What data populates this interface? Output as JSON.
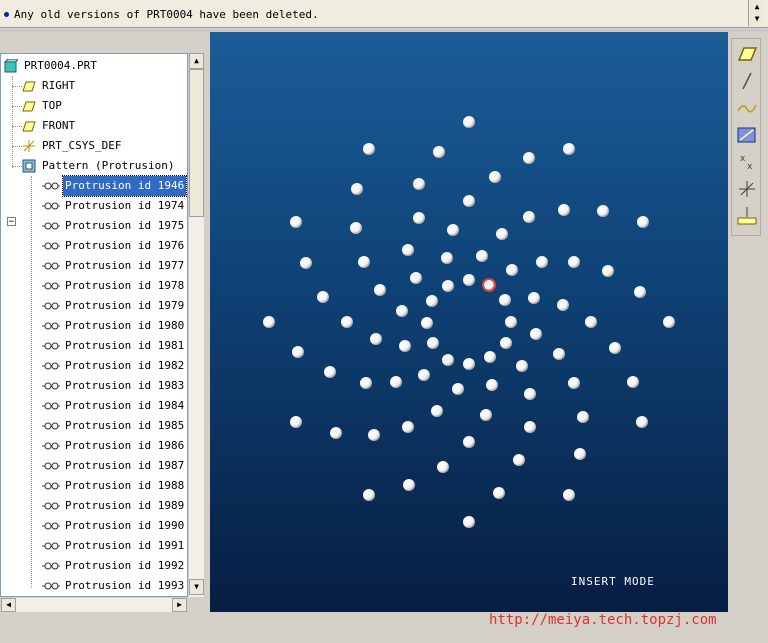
{
  "message_bar": {
    "text": "Any old versions of PRT0004 have been deleted."
  },
  "model_tree": {
    "root": "PRT0004.PRT",
    "items": [
      {
        "label": "RIGHT",
        "icon": "datum-plane-icon"
      },
      {
        "label": "TOP",
        "icon": "datum-plane-icon"
      },
      {
        "label": "FRONT",
        "icon": "datum-plane-icon"
      },
      {
        "label": "PRT_CSYS_DEF",
        "icon": "coordinate-system-icon"
      },
      {
        "label": "Pattern (Protrusion)",
        "icon": "pattern-icon"
      }
    ],
    "pattern_members": [
      "Protrusion id 1946",
      "Protrusion id 1974",
      "Protrusion id 1975",
      "Protrusion id 1976",
      "Protrusion id 1977",
      "Protrusion id 1978",
      "Protrusion id 1979",
      "Protrusion id 1980",
      "Protrusion id 1981",
      "Protrusion id 1982",
      "Protrusion id 1983",
      "Protrusion id 1984",
      "Protrusion id 1985",
      "Protrusion id 1986",
      "Protrusion id 1987",
      "Protrusion id 1988",
      "Protrusion id 1989",
      "Protrusion id 1990",
      "Protrusion id 1991",
      "Protrusion id 1992",
      "Protrusion id 1993"
    ],
    "selected_index": 0
  },
  "viewport": {
    "mode_label": "INSERT MODE",
    "background_top": "#1c5d98",
    "background_bottom": "#071e42",
    "sphere_color": "#f2f2f2",
    "selected_color": "#e04040"
  },
  "toolbar": {
    "tools": [
      "datum-plane-icon",
      "datum-axis-icon",
      "datum-curve-icon",
      "datum-point-icon",
      "point-icon",
      "coordinate-system-icon",
      "analysis-icon"
    ]
  },
  "watermark": {
    "text": "http://meiya.tech.topzj.com"
  }
}
